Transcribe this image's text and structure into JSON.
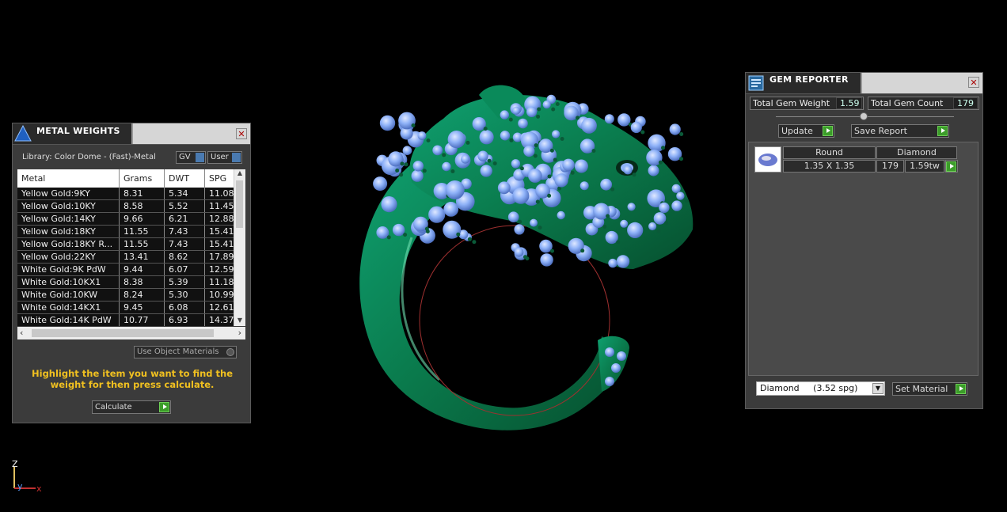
{
  "metal_weights": {
    "title": "METAL WEIGHTS",
    "library": "Library: Color Dome - (Fast)-Metal",
    "gv_label": "GV",
    "user_label": "User",
    "columns": [
      "Metal",
      "Grams",
      "DWT",
      "SPG"
    ],
    "rows": [
      [
        "Yellow Gold:9KY",
        "8.31",
        "5.34",
        "11.08"
      ],
      [
        "Yellow Gold:10KY",
        "8.58",
        "5.52",
        "11.45"
      ],
      [
        "Yellow Gold:14KY",
        "9.66",
        "6.21",
        "12.88"
      ],
      [
        "Yellow Gold:18KY",
        "11.55",
        "7.43",
        "15.41"
      ],
      [
        "Yellow Gold:18KY R...",
        "11.55",
        "7.43",
        "15.41"
      ],
      [
        "Yellow Gold:22KY",
        "13.41",
        "8.62",
        "17.89"
      ],
      [
        "White Gold:9K PdW",
        "9.44",
        "6.07",
        "12.59"
      ],
      [
        "White Gold:10KX1",
        "8.38",
        "5.39",
        "11.18"
      ],
      [
        "White Gold:10KW",
        "8.24",
        "5.30",
        "10.99"
      ],
      [
        "White Gold:14KX1",
        "9.45",
        "6.08",
        "12.61"
      ],
      [
        "White Gold:14K PdW",
        "10.77",
        "6.93",
        "14.37"
      ]
    ],
    "use_object_materials": "Use Object Materials",
    "instruction": "Highlight the item you want to find the weight for then press calculate.",
    "calculate_label": "Calculate"
  },
  "gem_reporter": {
    "title": "GEM REPORTER",
    "total_weight_label": "Total Gem Weight",
    "total_weight_value": "1.59",
    "total_count_label": "Total Gem Count",
    "total_count_value": "179",
    "update_label": "Update",
    "save_report_label": "Save Report",
    "table_header": [
      "Round",
      "Diamond"
    ],
    "table_row": {
      "size": "1.35 X 1.35",
      "count": "179",
      "weight": "1.59tw"
    },
    "material_select": "Diamond     (3.52 spg)",
    "set_material_label": "Set Material"
  },
  "axis": {
    "z": "Z",
    "y": "y",
    "x": "x"
  },
  "colors": {
    "panel_bg": "#3b3b3b",
    "instruction_text": "#f0c020",
    "ring_metal": "#0e8a5a",
    "gem": "#8fb2f8",
    "accent_green": "#3c9d2a"
  }
}
